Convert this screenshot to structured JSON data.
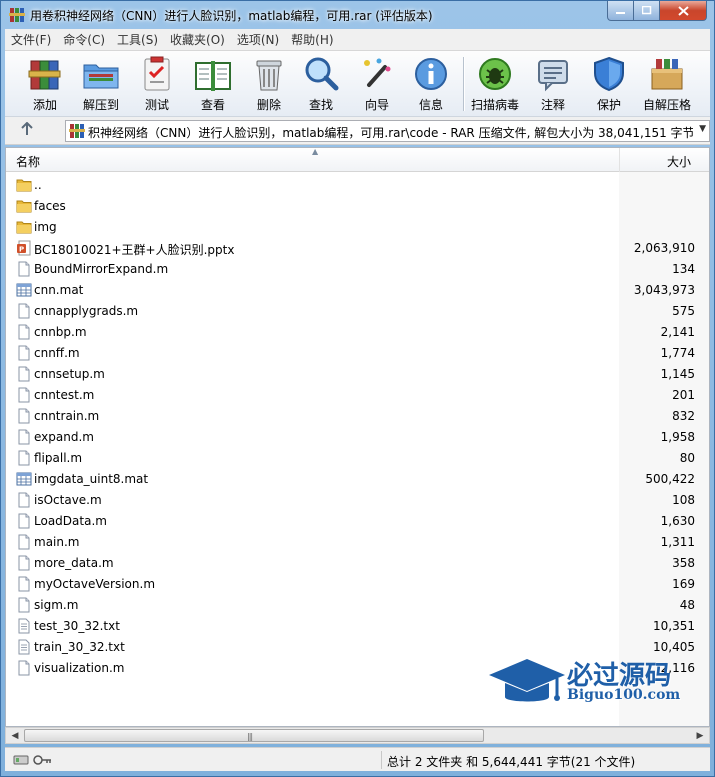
{
  "window": {
    "title": "用卷积神经网络（CNN）进行人脸识别，matlab编程，可用.rar (评估版本)"
  },
  "menu": [
    "文件(F)",
    "命令(C)",
    "工具(S)",
    "收藏夹(O)",
    "选项(N)",
    "帮助(H)"
  ],
  "toolbar": [
    {
      "label": "添加",
      "icon": "books-add-icon"
    },
    {
      "label": "解压到",
      "icon": "extract-folder-icon"
    },
    {
      "label": "测试",
      "icon": "test-clipboard-icon"
    },
    {
      "label": "查看",
      "icon": "view-book-icon"
    },
    {
      "label": "删除",
      "icon": "trash-icon"
    },
    {
      "label": "查找",
      "icon": "magnifier-icon"
    },
    {
      "label": "向导",
      "icon": "wizard-wand-icon"
    },
    {
      "label": "信息",
      "icon": "info-icon"
    },
    {
      "label": "扫描病毒",
      "icon": "bug-scan-icon"
    },
    {
      "label": "注释",
      "icon": "comment-icon"
    },
    {
      "label": "保护",
      "icon": "shield-icon"
    },
    {
      "label": "自解压格",
      "icon": "sfx-box-icon"
    }
  ],
  "address": {
    "path": "积神经网络（CNN）进行人脸识别，matlab编程，可用.rar\\code - RAR 压缩文件, 解包大小为 38,041,151 字节"
  },
  "columns": {
    "name": "名称",
    "size": "大小"
  },
  "files": [
    {
      "name": "..",
      "size": "",
      "type": "folder"
    },
    {
      "name": "faces",
      "size": "",
      "type": "folder"
    },
    {
      "name": "img",
      "size": "",
      "type": "folder"
    },
    {
      "name": "BC18010021+王群+人脸识别.pptx",
      "size": "2,063,910",
      "type": "pptx"
    },
    {
      "name": "BoundMirrorExpand.m",
      "size": "134",
      "type": "m"
    },
    {
      "name": "cnn.mat",
      "size": "3,043,973",
      "type": "mat"
    },
    {
      "name": "cnnapplygrads.m",
      "size": "575",
      "type": "m"
    },
    {
      "name": "cnnbp.m",
      "size": "2,141",
      "type": "m"
    },
    {
      "name": "cnnff.m",
      "size": "1,774",
      "type": "m"
    },
    {
      "name": "cnnsetup.m",
      "size": "1,145",
      "type": "m"
    },
    {
      "name": "cnntest.m",
      "size": "201",
      "type": "m"
    },
    {
      "name": "cnntrain.m",
      "size": "832",
      "type": "m"
    },
    {
      "name": "expand.m",
      "size": "1,958",
      "type": "m"
    },
    {
      "name": "flipall.m",
      "size": "80",
      "type": "m"
    },
    {
      "name": "imgdata_uint8.mat",
      "size": "500,422",
      "type": "mat"
    },
    {
      "name": "isOctave.m",
      "size": "108",
      "type": "m"
    },
    {
      "name": "LoadData.m",
      "size": "1,630",
      "type": "m"
    },
    {
      "name": "main.m",
      "size": "1,311",
      "type": "m"
    },
    {
      "name": "more_data.m",
      "size": "358",
      "type": "m"
    },
    {
      "name": "myOctaveVersion.m",
      "size": "169",
      "type": "m"
    },
    {
      "name": "sigm.m",
      "size": "48",
      "type": "m"
    },
    {
      "name": "test_30_32.txt",
      "size": "10,351",
      "type": "txt"
    },
    {
      "name": "train_30_32.txt",
      "size": "10,405",
      "type": "txt"
    },
    {
      "name": "visualization.m",
      "size": "2,116",
      "type": "m"
    }
  ],
  "status": {
    "text": "总计 2 文件夹 和 5,644,441 字节(21 个文件)"
  },
  "watermark": {
    "line1": "必过源码",
    "line2": "Biguo100.com"
  },
  "colors": {
    "accent": "#1f5fa8",
    "folder": "#e8b838",
    "title": "#7fb0dc"
  }
}
